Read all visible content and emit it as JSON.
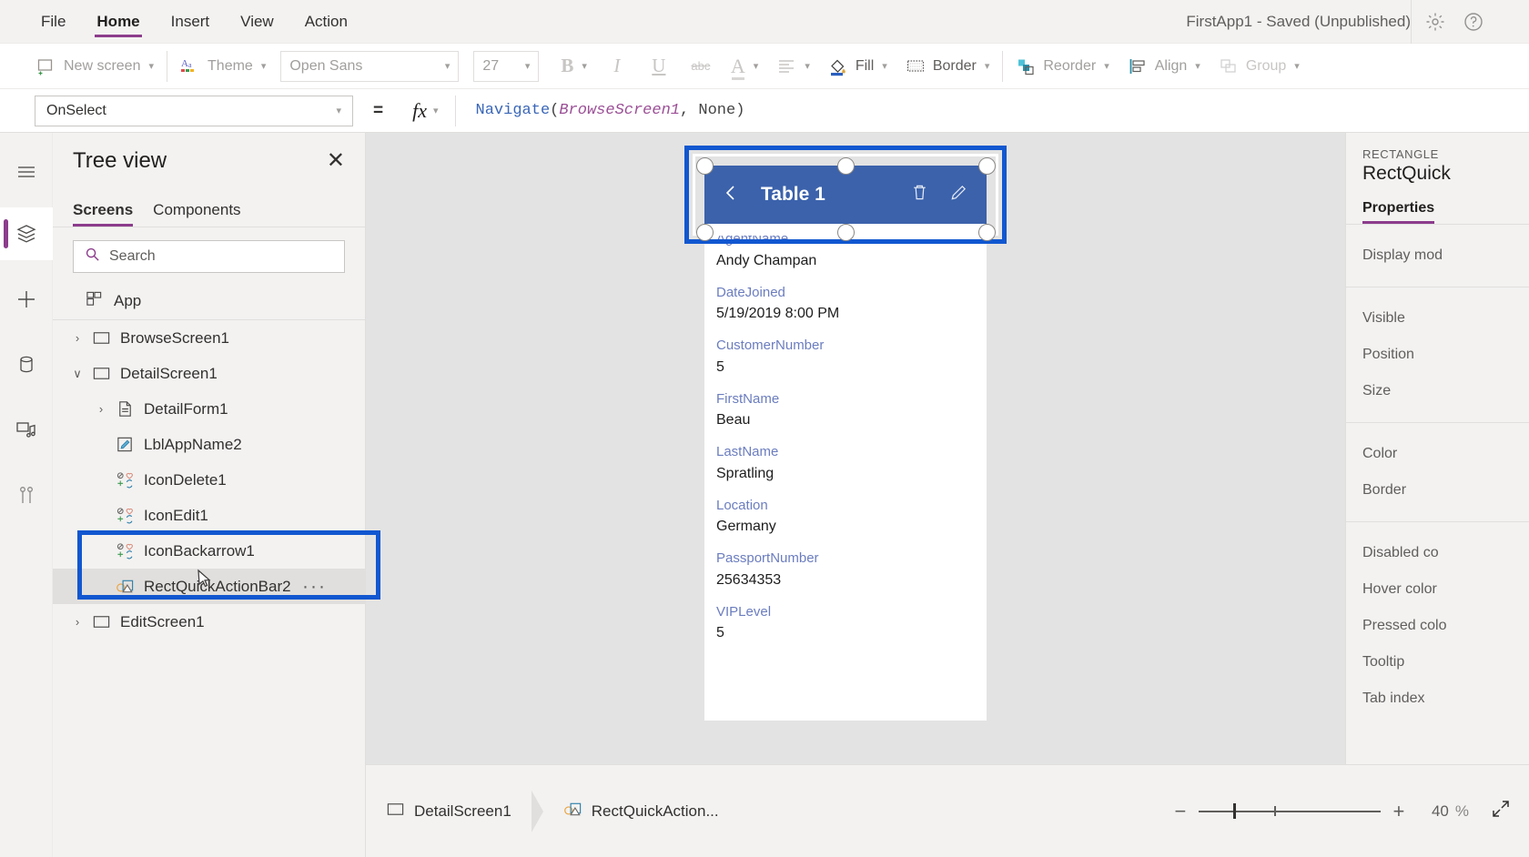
{
  "menubar": {
    "items": [
      {
        "label": "File",
        "active": false
      },
      {
        "label": "Home",
        "active": true
      },
      {
        "label": "Insert",
        "active": false
      },
      {
        "label": "View",
        "active": false
      },
      {
        "label": "Action",
        "active": false
      }
    ],
    "app_status": "FirstApp1 - Saved (Unpublished)"
  },
  "ribbon": {
    "new_screen": "New screen",
    "theme": "Theme",
    "font_family": "Open Sans",
    "font_size": "27",
    "bold": "B",
    "italic": "I",
    "underline": "U",
    "strikethrough": "abc",
    "font_color": "A",
    "align": "align-icon",
    "fill": "Fill",
    "border": "Border",
    "reorder": "Reorder",
    "align_label": "Align",
    "group": "Group"
  },
  "formula_bar": {
    "property": "OnSelect",
    "equals": "=",
    "fx": "fx",
    "formula_tokens": [
      {
        "t": "Navigate",
        "k": "fn"
      },
      {
        "t": "(",
        "k": "p"
      },
      {
        "t": "BrowseScreen1",
        "k": "id"
      },
      {
        "t": ", ",
        "k": "p"
      },
      {
        "t": "None",
        "k": "kw"
      },
      {
        "t": ")",
        "k": "p"
      }
    ],
    "formula_text": "Navigate(BrowseScreen1, None)"
  },
  "rail": {
    "items": [
      {
        "name": "hamburger-menu-icon",
        "selected": false
      },
      {
        "name": "tree-view-icon",
        "selected": true
      },
      {
        "name": "insert-plus-icon",
        "selected": false
      },
      {
        "name": "data-sources-icon",
        "selected": false
      },
      {
        "name": "media-icon",
        "selected": false
      },
      {
        "name": "advanced-tools-icon",
        "selected": false
      }
    ]
  },
  "tree_view": {
    "title": "Tree view",
    "close": "✕",
    "tabs": [
      {
        "label": "Screens",
        "active": true
      },
      {
        "label": "Components",
        "active": false
      }
    ],
    "search_placeholder": "Search",
    "app_item": "App",
    "nodes": [
      {
        "label": "BrowseScreen1",
        "icon": "screen-icon",
        "twisty": "›",
        "indent": 1,
        "selected": false
      },
      {
        "label": "DetailScreen1",
        "icon": "screen-icon",
        "twisty": "∨",
        "indent": 1,
        "selected": false
      },
      {
        "label": "DetailForm1",
        "icon": "form-icon",
        "twisty": "›",
        "indent": 2,
        "selected": false
      },
      {
        "label": "LblAppName2",
        "icon": "label-icon",
        "twisty": "",
        "indent": 2,
        "selected": false
      },
      {
        "label": "IconDelete1",
        "icon": "icon-control-icon",
        "twisty": "",
        "indent": 2,
        "selected": false
      },
      {
        "label": "IconEdit1",
        "icon": "icon-control-icon",
        "twisty": "",
        "indent": 2,
        "selected": false
      },
      {
        "label": "IconBackarrow1",
        "icon": "icon-control-icon",
        "twisty": "",
        "indent": 2,
        "selected": false
      },
      {
        "label": "RectQuickActionBar2",
        "icon": "rectangle-icon",
        "twisty": "",
        "indent": 2,
        "selected": true,
        "overflow": "···"
      },
      {
        "label": "EditScreen1",
        "icon": "screen-icon",
        "twisty": "›",
        "indent": 1,
        "selected": false
      }
    ]
  },
  "canvas": {
    "quick_action_bar": {
      "back_icon": "chevron-left-icon",
      "title": "Table 1",
      "delete_icon": "trash-icon",
      "edit_icon": "pencil-icon"
    },
    "form_fields": [
      {
        "key": "AgentName",
        "value": "Andy Champan"
      },
      {
        "key": "DateJoined",
        "value": "5/19/2019 8:00 PM"
      },
      {
        "key": "CustomerNumber",
        "value": "5"
      },
      {
        "key": "FirstName",
        "value": "Beau"
      },
      {
        "key": "LastName",
        "value": "Spratling"
      },
      {
        "key": "Location",
        "value": "Germany"
      },
      {
        "key": "PassportNumber",
        "value": "25634353"
      },
      {
        "key": "VIPLevel",
        "value": "5"
      }
    ]
  },
  "properties_panel": {
    "kicker": "RECTANGLE",
    "control_name": "RectQuick",
    "tab": "Properties",
    "groups": [
      [
        "Display mod"
      ],
      [
        "Visible",
        "Position",
        "Size"
      ],
      [
        "Color",
        "Border"
      ],
      [
        "Disabled co",
        "Hover color",
        "Pressed colo",
        "Tooltip",
        "Tab index"
      ]
    ]
  },
  "status_bar": {
    "breadcrumbs": [
      {
        "label": "DetailScreen1",
        "icon": "screen-icon"
      },
      {
        "label": "RectQuickAction...",
        "icon": "rectangle-icon"
      }
    ],
    "zoom_out": "−",
    "zoom_in": "+",
    "zoom_value": "40",
    "zoom_unit": "%",
    "fit_icon": "fit-to-screen-icon"
  },
  "colors": {
    "accent_purple": "#8c3c8c",
    "highlight_blue": "#1157d0",
    "qbar_blue": "#3b62ab",
    "panel_gray": "#f3f2f1",
    "canvas_gray": "#e3e3e3"
  }
}
